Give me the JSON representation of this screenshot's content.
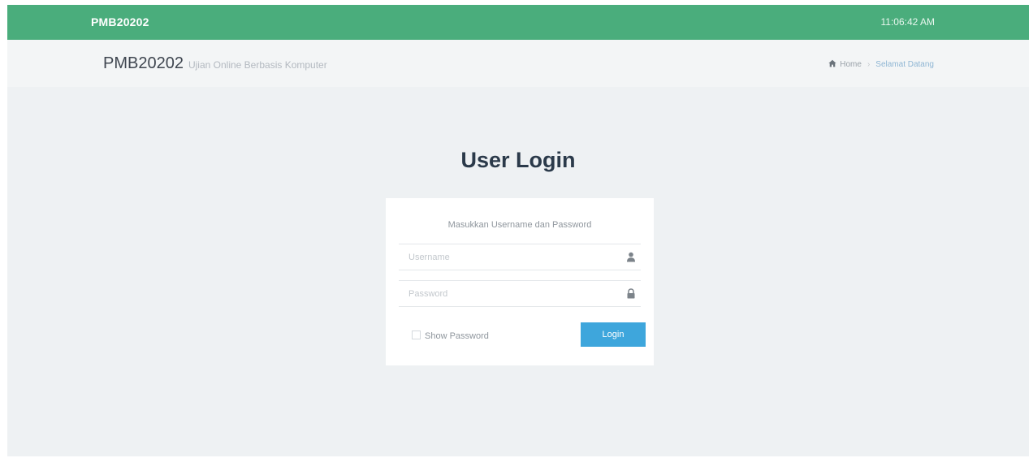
{
  "topbar": {
    "brand": "PMB20202",
    "clock": "11:06:42 AM",
    "color": "#4aad7c"
  },
  "subheader": {
    "title": "PMB20202",
    "subtitle": "Ujian Online Berbasis Komputer"
  },
  "breadcrumb": {
    "home_icon": "home-icon",
    "home": "Home",
    "current": "Selamat Datang"
  },
  "login": {
    "heading": "User Login",
    "hint": "Masukkan Username dan Password",
    "username": {
      "placeholder": "Username",
      "value": "",
      "icon": "user-icon"
    },
    "password": {
      "placeholder": "Password",
      "value": "",
      "icon": "lock-icon"
    },
    "show_password_label": "Show Password",
    "button_label": "Login",
    "button_color": "#3ea6dc"
  }
}
